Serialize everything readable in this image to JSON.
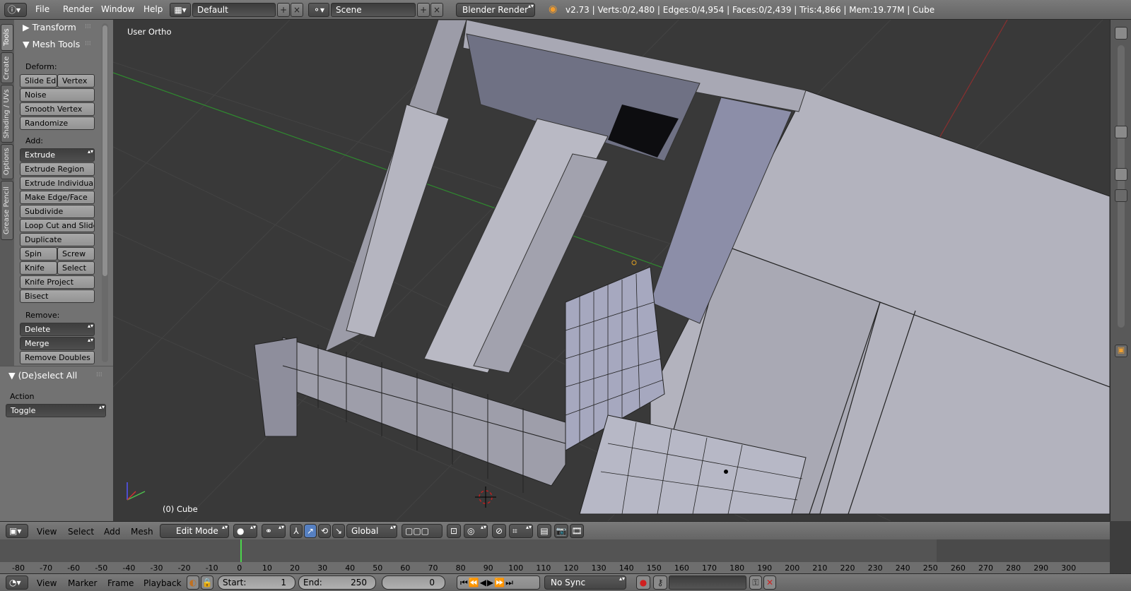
{
  "top_header": {
    "menus": [
      "File",
      "Render",
      "Window",
      "Help"
    ],
    "layout": "Default",
    "scene": "Scene",
    "engine": "Blender Render",
    "stats": "v2.73 | Verts:0/2,480 | Edges:0/4,954 | Faces:0/2,439 | Tris:4,866 | Mem:19.77M | Cube"
  },
  "tabs": [
    "Tools",
    "Create",
    "Shading / UVs",
    "Options",
    "Grease Pencil"
  ],
  "tool_shelf": {
    "transform_title": "Transform",
    "mesh_tools_title": "Mesh Tools",
    "deform_label": "Deform:",
    "deform": {
      "slide_edge": "Slide Ed",
      "vertex": "Vertex",
      "noise": "Noise",
      "smooth": "Smooth Vertex",
      "randomize": "Randomize"
    },
    "add_label": "Add:",
    "add": {
      "extrude": "Extrude",
      "extrude_region": "Extrude Region",
      "extrude_individual": "Extrude Individual",
      "make_edge_face": "Make Edge/Face",
      "subdivide": "Subdivide",
      "loop_cut": "Loop Cut and Slide",
      "duplicate": "Duplicate",
      "spin": "Spin",
      "screw": "Screw",
      "knife": "Knife",
      "select": "Select",
      "knife_project": "Knife Project",
      "bisect": "Bisect"
    },
    "remove_label": "Remove:",
    "remove": {
      "delete": "Delete",
      "merge": "Merge",
      "remove_doubles": "Remove Doubles"
    }
  },
  "redo_panel": {
    "title": "(De)select All",
    "action_label": "Action",
    "action_value": "Toggle"
  },
  "viewport": {
    "view_name": "User Ortho",
    "object_label": "(0) Cube"
  },
  "view3d_header": {
    "menus": [
      "View",
      "Select",
      "Add",
      "Mesh"
    ],
    "mode": "Edit Mode",
    "orientation": "Global"
  },
  "timeline": {
    "ticks": [
      "-80",
      "-70",
      "-60",
      "-50",
      "-40",
      "-30",
      "-20",
      "-10",
      "0",
      "10",
      "20",
      "30",
      "40",
      "50",
      "60",
      "70",
      "80",
      "90",
      "100",
      "110",
      "120",
      "130",
      "140",
      "150",
      "160",
      "170",
      "180",
      "190",
      "200",
      "210",
      "220",
      "230",
      "240",
      "250",
      "260",
      "270",
      "280",
      "290",
      "300"
    ],
    "current_frame": "0",
    "menus": [
      "View",
      "Marker",
      "Frame",
      "Playback"
    ],
    "start_label": "Start:",
    "start_value": "1",
    "end_label": "End:",
    "end_value": "250",
    "frame_value": "0",
    "sync": "No Sync"
  }
}
